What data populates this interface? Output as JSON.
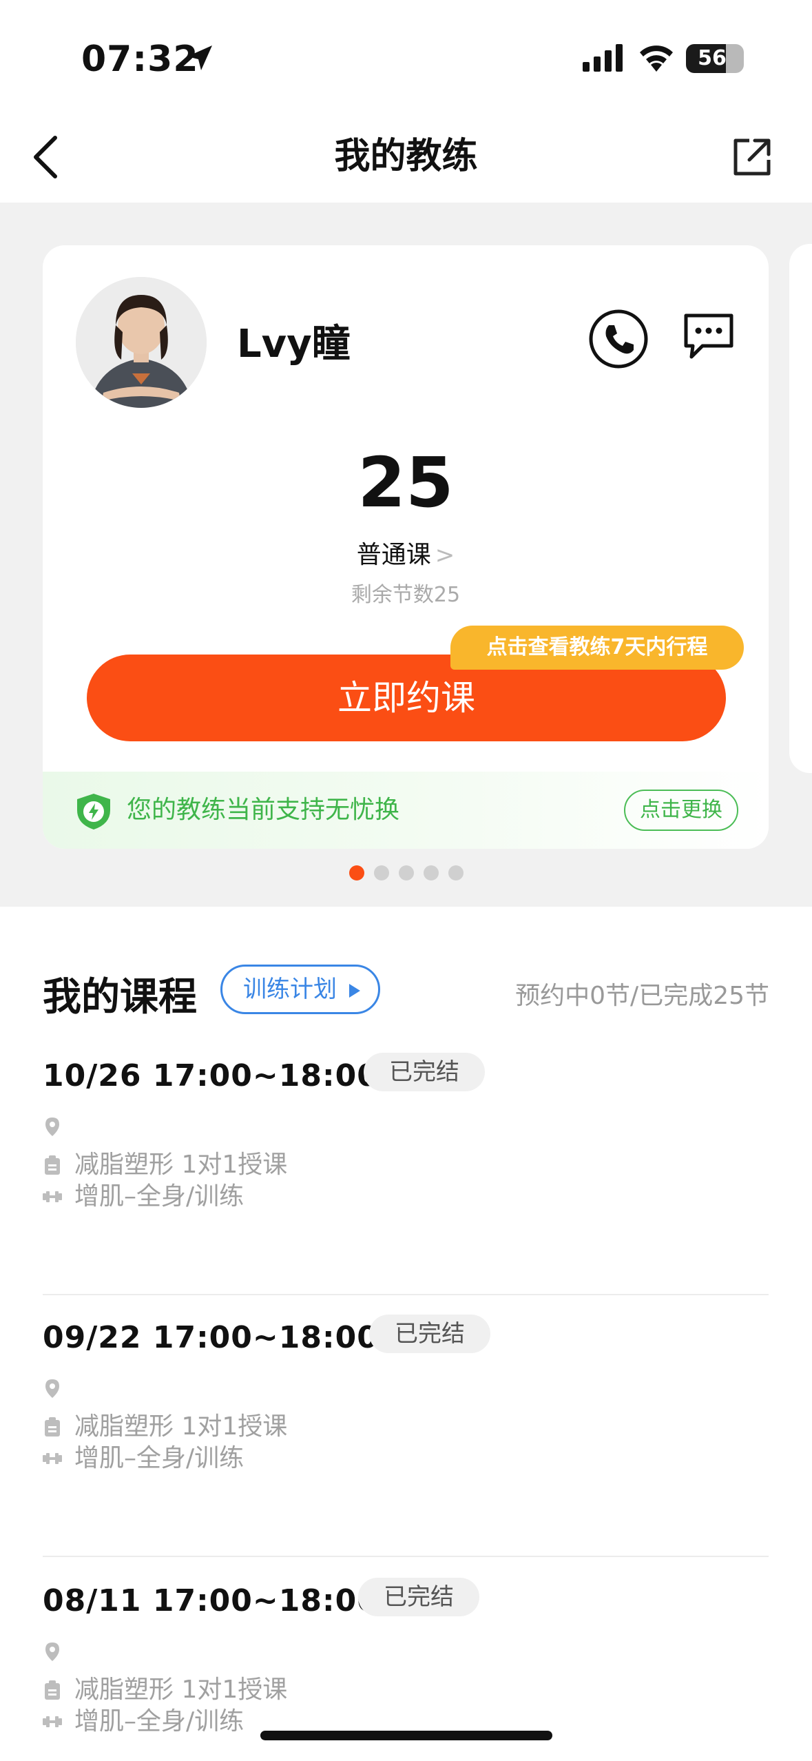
{
  "status_bar": {
    "time": "07:32",
    "battery": "56"
  },
  "nav": {
    "title": "我的教练"
  },
  "coach_card": {
    "name": "Lvy瞳",
    "lesson_count": "25",
    "course_type": "普通课",
    "chevron": ">",
    "remaining": "剩余节数25",
    "schedule_tag": "点击查看教练7天内行程",
    "book_button": "立即约课",
    "guarantee_text": "您的教练当前支持无忧换",
    "swap_button": "点击更换"
  },
  "carousel": {
    "count": 5,
    "active": 1
  },
  "courses": {
    "title": "我的课程",
    "plan_button": "训练计划",
    "summary": "预约中0节/已完成25节",
    "items": [
      {
        "time": "10/26  17:00~18:00",
        "status": "已完结",
        "location": "",
        "course": "减脂塑形 1对1授课",
        "content": "增肌–全身/训练"
      },
      {
        "time": "09/22  17:00~18:00",
        "status": "已完结",
        "location": "",
        "course": "减脂塑形 1对1授课",
        "content": "增肌–全身/训练"
      },
      {
        "time": "08/11  17:00~18:00",
        "status": "已完结",
        "location": "",
        "course": "减脂塑形 1对1授课",
        "content": "增肌–全身/训练"
      }
    ]
  },
  "colors": {
    "accent": "#fb4e14",
    "tag": "#f9b62c",
    "green": "#3fb54a",
    "blue": "#3a86e5"
  }
}
